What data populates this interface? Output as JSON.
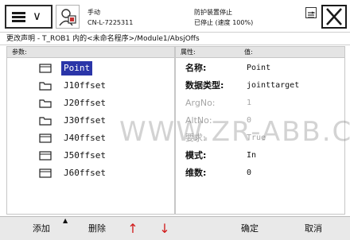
{
  "header": {
    "status_line1": "手动",
    "status_line2": "CN-L-7225311",
    "status_right1": "防护装置停止",
    "status_right2": "已停止 (速度 100%)",
    "icons": {
      "menu": "hamburger-icon",
      "robot": "robot-user-icon",
      "toggle": "toggle-view-icon",
      "close": "close-icon"
    }
  },
  "breadcrumb": "更改声明 - T_ROB1 内的<未命名程序>/Module1/AbsjOffs",
  "left": {
    "header": "参数:",
    "items": [
      {
        "label": "Point",
        "icon": "document-icon",
        "selected": true
      },
      {
        "label": "J10ffset",
        "icon": "folder-icon"
      },
      {
        "label": "J20ffset",
        "icon": "folder-icon"
      },
      {
        "label": "J30ffset",
        "icon": "folder-icon"
      },
      {
        "label": "J40ffset",
        "icon": "document-icon"
      },
      {
        "label": "J50ffset",
        "icon": "document-icon"
      },
      {
        "label": "J60ffset",
        "icon": "document-icon"
      }
    ]
  },
  "right": {
    "header_attr": "属性:",
    "header_value": "值:",
    "rows": [
      {
        "key": "名称:",
        "value": "Point",
        "dim": false,
        "bold": true
      },
      {
        "key": "数据类型:",
        "value": "jointtarget",
        "dim": false,
        "bold": true
      },
      {
        "key": "ArgNo:",
        "value": "1",
        "dim": true
      },
      {
        "key": "AltNo:",
        "value": "0",
        "dim": true
      },
      {
        "key": "要求:",
        "value": "True",
        "dim": true
      },
      {
        "key": "模式:",
        "value": "In",
        "dim": false,
        "bold": true
      },
      {
        "key": "维数:",
        "value": "0",
        "dim": false,
        "bold": true
      }
    ]
  },
  "watermark": "WWW.ZR-ABB.COM",
  "toolbar": {
    "add": "添加",
    "delete": "删除",
    "up": "↑",
    "down": "↓",
    "ok": "确定",
    "cancel": "取消"
  },
  "colors": {
    "selection": "#2a35a8",
    "arrows": "#d11a1a",
    "toolbar": "#e9e9e9"
  }
}
